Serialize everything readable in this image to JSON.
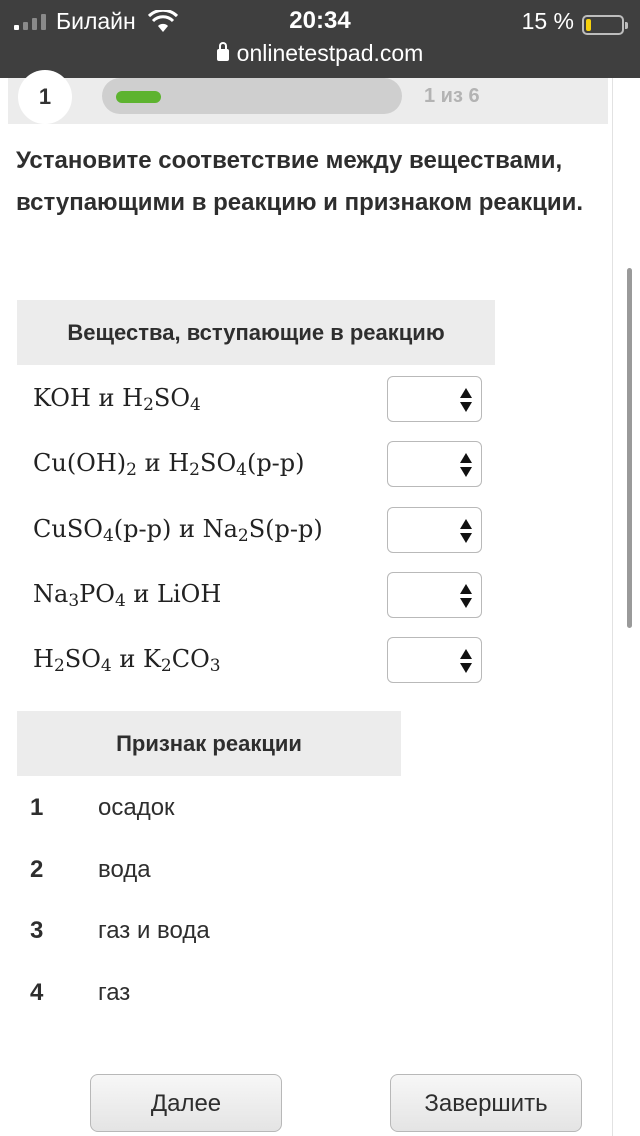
{
  "status_bar": {
    "carrier": "Билайн",
    "time": "20:34",
    "battery_percent": "15 %",
    "battery_level": 0.15,
    "signal_bars_active": 1,
    "signal_bars_total": 4
  },
  "browser": {
    "url": "onlinetestpad.com"
  },
  "progress": {
    "question_number": "1",
    "counter": "1 из 6",
    "fraction": 0.1667,
    "fill_color": "#5db32f"
  },
  "question": {
    "text": "Установите соответствие между веществами, вступающими в реакцию и признаком реакции."
  },
  "substances": {
    "header": "Вещества, вступающие в реакцию",
    "rows": [
      {
        "parts": [
          [
            "KOH и H",
            "2",
            "SO",
            "4"
          ]
        ]
      },
      {
        "parts": [
          [
            "Cu(OH)",
            "2",
            " и  H",
            "2",
            "SO",
            "4",
            "(р-р)"
          ]
        ]
      },
      {
        "parts": [
          [
            "CuSO",
            "4",
            "(р-р)  и  Na",
            "2",
            "S(р-р)"
          ]
        ]
      },
      {
        "parts": [
          [
            "Na",
            "3",
            "PO",
            "4",
            " и LiOH"
          ]
        ]
      },
      {
        "parts": [
          [
            "H",
            "2",
            "SO",
            "4",
            " и K",
            "2",
            "CO",
            "3"
          ]
        ]
      }
    ],
    "select_value": ""
  },
  "signs": {
    "header": "Признак реакции",
    "items": [
      {
        "num": "1",
        "text": "осадок"
      },
      {
        "num": "2",
        "text": "вода"
      },
      {
        "num": "3",
        "text": "газ и вода"
      },
      {
        "num": "4",
        "text": "газ"
      }
    ]
  },
  "buttons": {
    "next": "Далее",
    "finish": "Завершить"
  }
}
